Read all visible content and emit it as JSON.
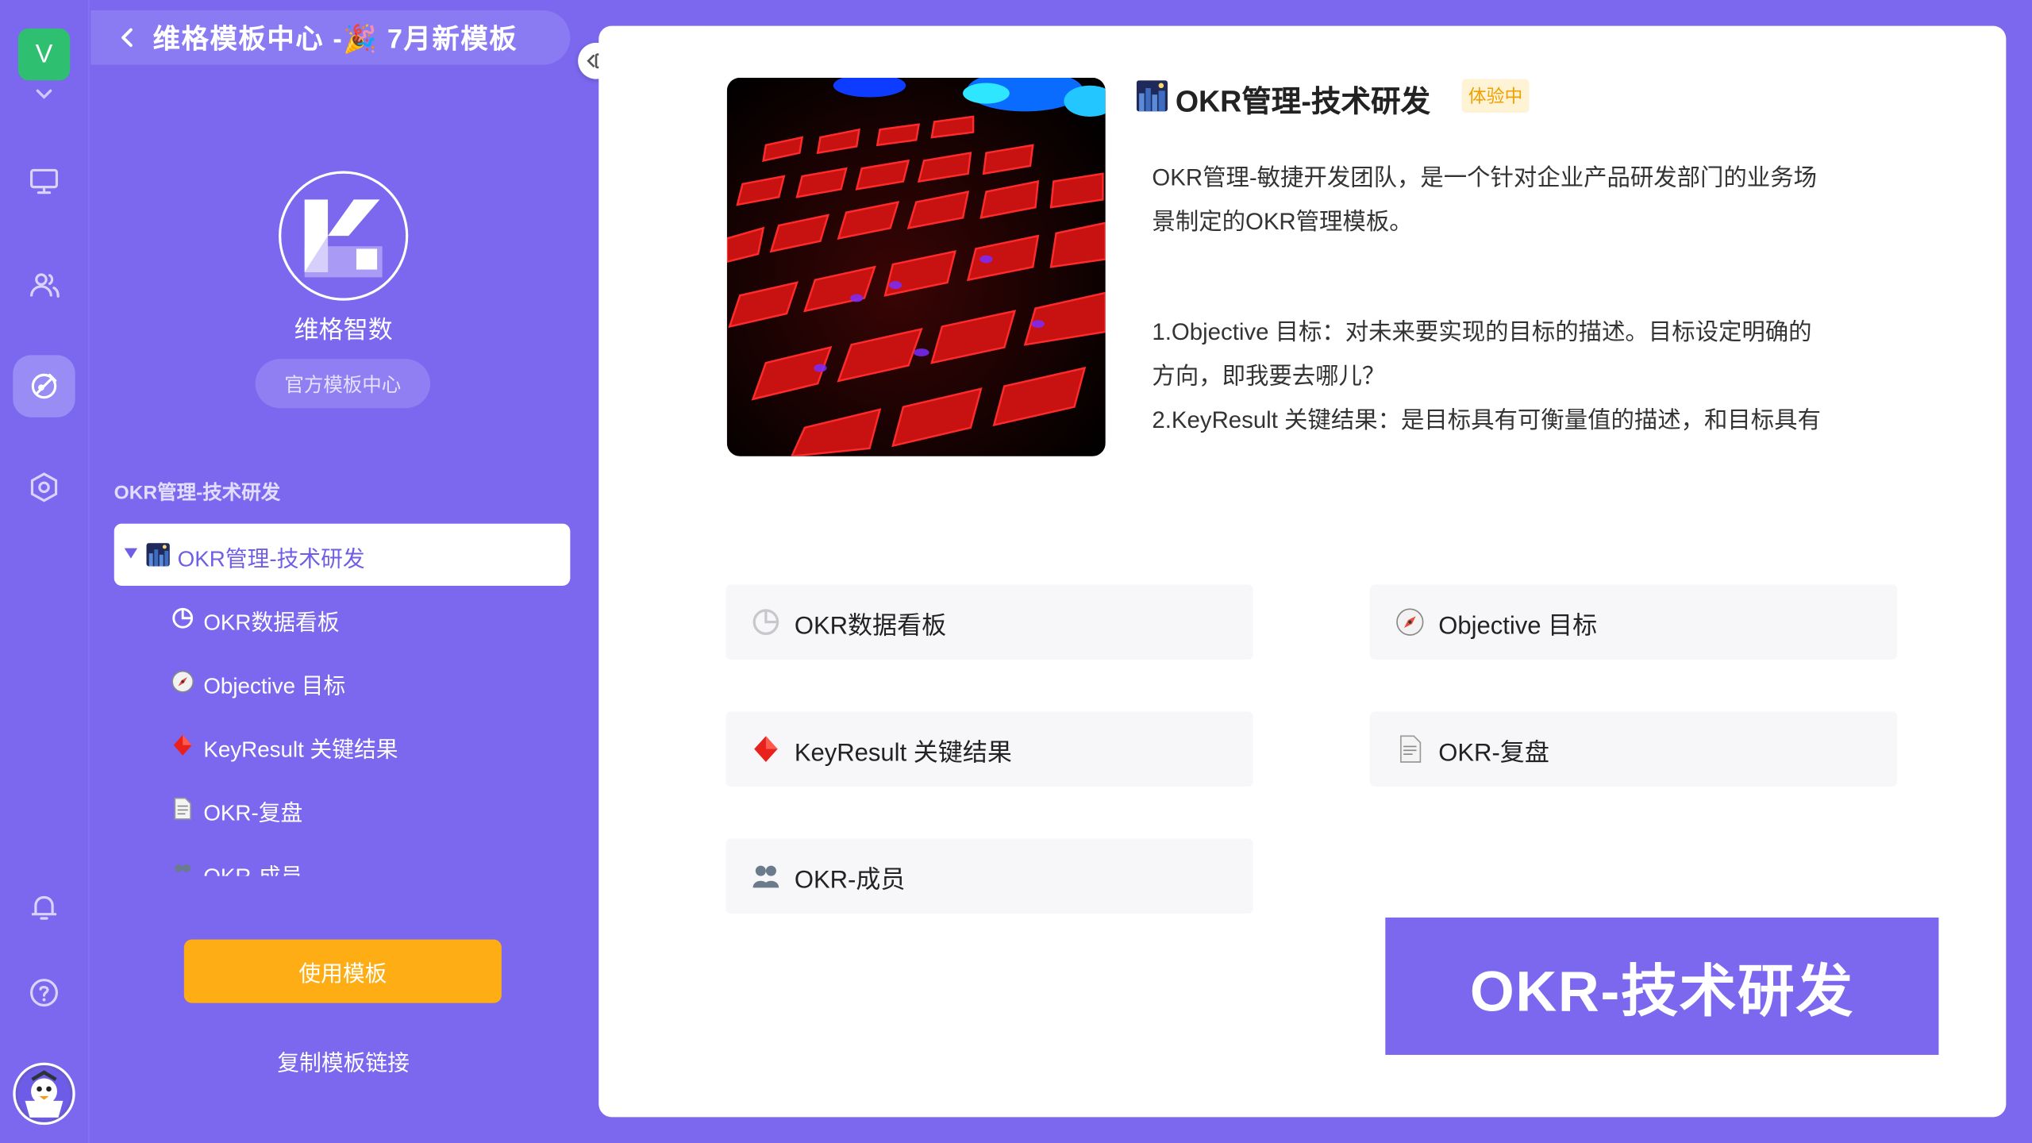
{
  "rail": {
    "workspace_initial": "V",
    "icons": [
      "monitor-icon",
      "members-icon",
      "template-center-icon",
      "settings-hex-icon",
      "bell-icon",
      "help-icon",
      "user-avatar"
    ]
  },
  "side": {
    "back_title": "维格模板中心 -🎉 7月新模板",
    "org_name": "维格智数",
    "org_tag": "官方模板中心",
    "section_title": "OKR管理-技术研发",
    "tree_root": "OKR管理-技术研发",
    "tree_items": [
      "OKR数据看板",
      "Objective 目标",
      "KeyResult 关键结果",
      "OKR-复盘",
      "OKR-成员"
    ],
    "use_template": "使用模板",
    "copy_link": "复制模板链接"
  },
  "main": {
    "title": "OKR管理-技术研发",
    "badge": "体验中",
    "description": [
      "OKR管理-敏捷开发团队，是一个针对企业产品研发部门的业务场",
      "景制定的OKR管理模板。",
      "1.Objective 目标：对未来要实现的目标的描述。目标设定明确的",
      "方向，即我要去哪儿？",
      "2.KeyResult 关键结果：是目标具有可衡量值的描述，和目标具有"
    ],
    "entries": [
      {
        "label": "OKR数据看板",
        "icon": "pie-chart-icon"
      },
      {
        "label": "Objective 目标",
        "icon": "compass-icon"
      },
      {
        "label": "KeyResult 关键结果",
        "icon": "diamond-icon"
      },
      {
        "label": "OKR-复盘",
        "icon": "document-icon"
      },
      {
        "label": "OKR-成员",
        "icon": "members-icon"
      }
    ],
    "banner": "OKR-技术研发"
  },
  "colors": {
    "brand": "#7b68ee",
    "accent": "#ffad14",
    "badge_bg": "#fff3d6",
    "badge_text": "#f0a000"
  }
}
